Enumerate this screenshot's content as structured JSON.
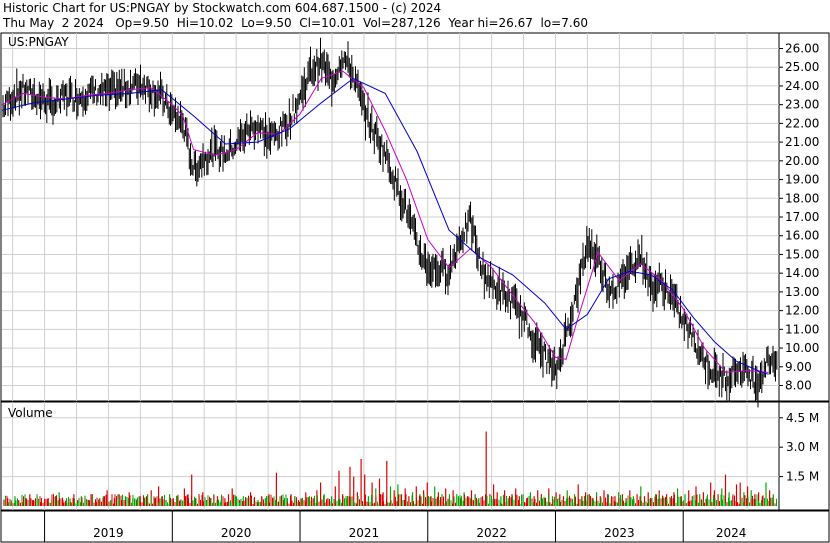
{
  "header": {
    "line1": "Historic Chart for US:PNGAY by Stockwatch.com 604.687.1500 - (c) 2024",
    "line2": "Thu May  2 2024   Op=9.50  Hi=10.02  Lo=9.50  Cl=10.01  Vol=287,126  Year hi=26.67  lo=7.60"
  },
  "chart_data": [
    {
      "type": "line",
      "title": "US:PNGAY",
      "ylim": [
        7.6,
        26.67
      ],
      "grid": true,
      "y_ticks": [
        "26.00",
        "25.00",
        "24.00",
        "23.00",
        "22.00",
        "21.00",
        "20.00",
        "19.00",
        "18.00",
        "17.00",
        "16.00",
        "15.00",
        "14.00",
        "13.00",
        "12.00",
        "11.00",
        "10.00",
        "9.00",
        "8.00"
      ],
      "x_ticks": [
        "2019",
        "2020",
        "2021",
        "2022",
        "2023",
        "2024"
      ],
      "price_color": "#000000",
      "series": [
        {
          "name": "",
          "color": "#000000",
          "points": [
            [
              "2018-09",
              22.8
            ],
            [
              "2018-10",
              23.4
            ],
            [
              "2018-11",
              23.8
            ],
            [
              "2018-12",
              23.5
            ],
            [
              "2019-01",
              23.2
            ],
            [
              "2019-02",
              23.0
            ],
            [
              "2019-03",
              23.5
            ],
            [
              "2019-04",
              23.4
            ],
            [
              "2019-05",
              23.6
            ],
            [
              "2019-06",
              23.7
            ],
            [
              "2019-07",
              23.6
            ],
            [
              "2019-08",
              23.8
            ],
            [
              "2019-09",
              23.9
            ],
            [
              "2019-10",
              24.2
            ],
            [
              "2019-11",
              23.8
            ],
            [
              "2019-12",
              23.4
            ],
            [
              "2020-01",
              22.5
            ],
            [
              "2020-02",
              22.0
            ],
            [
              "2020-03",
              19.5
            ],
            [
              "2020-04",
              20.2
            ],
            [
              "2020-05",
              20.6
            ],
            [
              "2020-06",
              20.4
            ],
            [
              "2020-07",
              20.9
            ],
            [
              "2020-08",
              21.6
            ],
            [
              "2020-09",
              21.9
            ],
            [
              "2020-10",
              21.2
            ],
            [
              "2020-11",
              21.5
            ],
            [
              "2020-12",
              22.2
            ],
            [
              "2021-01",
              23.4
            ],
            [
              "2021-02",
              24.8
            ],
            [
              "2021-03",
              25.3
            ],
            [
              "2021-04",
              24.2
            ],
            [
              "2021-05",
              25.6
            ],
            [
              "2021-06",
              24.6
            ],
            [
              "2021-07",
              22.7
            ],
            [
              "2021-08",
              21.5
            ],
            [
              "2021-09",
              20.4
            ],
            [
              "2021-10",
              18.8
            ],
            [
              "2021-11",
              17.4
            ],
            [
              "2021-12",
              15.5
            ],
            [
              "2022-01",
              14.3
            ],
            [
              "2022-02",
              14.2
            ],
            [
              "2022-03",
              14.1
            ],
            [
              "2022-04",
              15.8
            ],
            [
              "2022-05",
              16.8
            ],
            [
              "2022-06",
              14.3
            ],
            [
              "2022-07",
              13.4
            ],
            [
              "2022-08",
              12.9
            ],
            [
              "2022-09",
              12.4
            ],
            [
              "2022-10",
              11.6
            ],
            [
              "2022-11",
              10.4
            ],
            [
              "2022-12",
              9.6
            ],
            [
              "2023-01",
              8.6
            ],
            [
              "2023-02",
              10.8
            ],
            [
              "2023-03",
              12.9
            ],
            [
              "2023-04",
              15.6
            ],
            [
              "2023-05",
              14.8
            ],
            [
              "2023-06",
              13.2
            ],
            [
              "2023-07",
              13.3
            ],
            [
              "2023-08",
              14.4
            ],
            [
              "2023-09",
              15.0
            ],
            [
              "2023-10",
              13.2
            ],
            [
              "2023-11",
              13.4
            ],
            [
              "2023-12",
              12.7
            ],
            [
              "2024-01",
              11.4
            ],
            [
              "2024-02",
              10.5
            ],
            [
              "2024-03",
              9.3
            ],
            [
              "2024-04",
              8.6
            ],
            [
              "2024-05",
              8.4
            ],
            [
              "2024-06",
              8.9
            ],
            [
              "2024-07",
              8.7
            ],
            [
              "2024-08",
              8.2
            ],
            [
              "2024-09",
              9.4
            ]
          ]
        },
        {
          "name": "",
          "color": "#cc00cc",
          "points": [
            [
              "2018-09",
              23.0
            ],
            [
              "2018-11",
              23.6
            ],
            [
              "2019-01",
              23.4
            ],
            [
              "2019-03",
              23.3
            ],
            [
              "2019-05",
              23.5
            ],
            [
              "2019-07",
              23.6
            ],
            [
              "2019-09",
              23.8
            ],
            [
              "2019-11",
              23.9
            ],
            [
              "2020-01",
              23.0
            ],
            [
              "2020-02",
              22.4
            ],
            [
              "2020-03",
              20.6
            ],
            [
              "2020-05",
              20.3
            ],
            [
              "2020-07",
              20.6
            ],
            [
              "2020-09",
              21.5
            ],
            [
              "2020-11",
              21.4
            ],
            [
              "2021-01",
              22.5
            ],
            [
              "2021-03",
              24.4
            ],
            [
              "2021-05",
              24.8
            ],
            [
              "2021-07",
              23.9
            ],
            [
              "2021-09",
              21.6
            ],
            [
              "2021-11",
              19.0
            ],
            [
              "2022-01",
              15.8
            ],
            [
              "2022-03",
              14.3
            ],
            [
              "2022-05",
              15.3
            ],
            [
              "2022-07",
              14.3
            ],
            [
              "2022-09",
              12.8
            ],
            [
              "2022-11",
              11.4
            ],
            [
              "2023-01",
              9.5
            ],
            [
              "2023-02",
              9.4
            ],
            [
              "2023-03",
              11.4
            ],
            [
              "2023-05",
              15.1
            ],
            [
              "2023-07",
              13.6
            ],
            [
              "2023-09",
              14.5
            ],
            [
              "2023-11",
              13.6
            ],
            [
              "2024-01",
              12.1
            ],
            [
              "2024-03",
              10.0
            ],
            [
              "2024-05",
              8.7
            ],
            [
              "2024-07",
              8.8
            ],
            [
              "2024-09",
              8.7
            ]
          ]
        },
        {
          "name": "",
          "color": "#0000cc",
          "points": [
            [
              "2018-09",
              22.7
            ],
            [
              "2018-12",
              23.1
            ],
            [
              "2019-03",
              23.3
            ],
            [
              "2019-06",
              23.5
            ],
            [
              "2019-09",
              23.6
            ],
            [
              "2019-12",
              23.8
            ],
            [
              "2020-03",
              22.4
            ],
            [
              "2020-06",
              20.9
            ],
            [
              "2020-09",
              21.0
            ],
            [
              "2020-12",
              21.7
            ],
            [
              "2021-03",
              23.1
            ],
            [
              "2021-06",
              24.4
            ],
            [
              "2021-09",
              23.6
            ],
            [
              "2021-12",
              20.5
            ],
            [
              "2022-03",
              16.3
            ],
            [
              "2022-06",
              14.8
            ],
            [
              "2022-09",
              13.9
            ],
            [
              "2022-12",
              12.4
            ],
            [
              "2023-02",
              11.0
            ],
            [
              "2023-04",
              11.8
            ],
            [
              "2023-06",
              13.7
            ],
            [
              "2023-08",
              14.1
            ],
            [
              "2023-10",
              13.9
            ],
            [
              "2023-12",
              13.1
            ],
            [
              "2024-02",
              11.6
            ],
            [
              "2024-04",
              10.3
            ],
            [
              "2024-06",
              9.3
            ],
            [
              "2024-08",
              8.8
            ],
            [
              "2024-09",
              8.6
            ]
          ]
        }
      ]
    },
    {
      "type": "bar",
      "title": "Volume",
      "ylim": [
        0,
        5.0
      ],
      "y_ticks": [
        "4.5 M",
        "3.0 M",
        "1.5 M"
      ],
      "up_color": "#00aa00",
      "down_color": "#dd0000",
      "values": [
        0.3,
        0.4,
        0.2,
        0.5,
        0.3,
        0.2,
        0.4,
        0.6,
        0.3,
        0.5,
        0.2,
        0.3,
        0.4,
        0.3,
        0.5,
        0.7,
        0.3,
        0.4,
        0.2,
        0.6,
        0.3,
        0.5,
        0.4,
        0.3,
        0.6,
        0.2,
        0.4,
        0.5,
        0.8,
        0.3,
        0.4,
        0.6,
        0.3,
        0.5,
        0.7,
        0.4,
        0.3,
        0.5,
        0.4,
        0.6,
        0.8,
        0.4,
        1.0,
        0.5,
        0.3,
        0.6,
        0.4,
        0.5,
        0.3,
        0.9,
        0.6,
        1.6,
        0.4,
        0.5,
        0.7,
        0.3,
        0.4,
        0.6,
        0.5,
        0.3,
        0.4,
        0.6,
        0.9,
        0.5,
        0.3,
        0.5,
        0.4,
        0.7,
        0.4,
        0.3,
        0.5,
        0.4,
        0.6,
        0.4,
        1.7,
        0.5,
        0.3,
        0.4,
        0.6,
        0.5,
        0.3,
        0.4,
        0.7,
        0.5,
        0.4,
        0.8,
        1.2,
        0.6,
        0.4,
        0.5,
        1.0,
        1.8,
        0.6,
        0.4,
        2.0,
        1.5,
        0.7,
        2.4,
        1.6,
        0.5,
        1.2,
        0.9,
        1.4,
        0.7,
        2.3,
        1.0,
        0.8,
        1.1,
        0.6,
        0.9,
        0.5,
        0.7,
        1.0,
        0.6,
        0.8,
        1.2,
        0.5,
        1.0,
        0.7,
        0.6,
        0.9,
        0.5,
        0.8,
        0.6,
        0.4,
        0.7,
        0.5,
        0.8,
        0.6,
        0.4,
        0.5,
        3.8,
        0.6,
        1.1,
        0.7,
        0.5,
        0.8,
        0.4,
        0.6,
        0.9,
        0.5,
        0.6,
        0.4,
        0.7,
        0.5,
        0.8,
        0.6,
        0.4,
        0.9,
        0.5,
        0.7,
        0.6,
        0.5,
        0.8,
        0.4,
        0.6,
        1.1,
        0.5,
        0.7,
        0.6,
        0.4,
        0.7,
        0.5,
        0.8,
        0.6,
        0.4,
        0.5,
        0.7,
        0.6,
        0.4,
        0.8,
        0.5,
        0.6,
        1.0,
        0.5,
        0.7,
        0.4,
        0.6,
        0.8,
        0.5,
        0.6,
        0.4,
        0.7,
        0.9,
        0.5,
        0.6,
        0.8,
        0.5,
        1.0,
        0.6,
        0.7,
        0.5,
        1.2,
        0.8,
        0.6,
        0.9,
        1.6,
        0.7,
        0.5,
        1.1,
        1.2,
        0.7,
        1.0,
        0.8,
        0.6,
        0.7,
        0.5,
        1.2,
        0.8,
        0.6
      ]
    }
  ]
}
